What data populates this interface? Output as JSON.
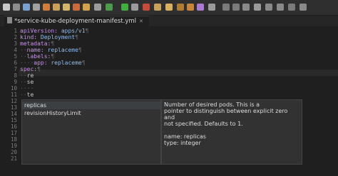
{
  "editor": {
    "tab_title": "*service-kube-deployment-manifest.yml",
    "line_numbers": [
      "1",
      "2",
      "3",
      "4",
      "5",
      "6",
      "7",
      "8",
      "9",
      "10",
      "11",
      "12",
      "13",
      "14",
      "15",
      "16",
      "17",
      "18",
      "19",
      "20",
      "21"
    ],
    "code": {
      "l1_key": "apiVersion:",
      "l1_val": "apps/v1",
      "l2_key": "kind:",
      "l2_val": "Deployment",
      "l3_key": "metadata:",
      "l4_key": "name:",
      "l4_val": "replaceme",
      "l5_key": "labels:",
      "l6_key": "app:",
      "l6_val": "replaceme",
      "l7_key": "spec:",
      "l8_text": "re",
      "l9_text": "se",
      "l11_text": "te"
    }
  },
  "content_assist": {
    "items": [
      "replicas",
      "revisionHistoryLimit"
    ],
    "doc": {
      "line1": "Number of desired pods. This is a",
      "line2": "pointer to distinguish between explicit zero and",
      "line3": "not specified. Defaults to 1.",
      "line4": "name: replicas",
      "line5": "type: integer"
    }
  }
}
